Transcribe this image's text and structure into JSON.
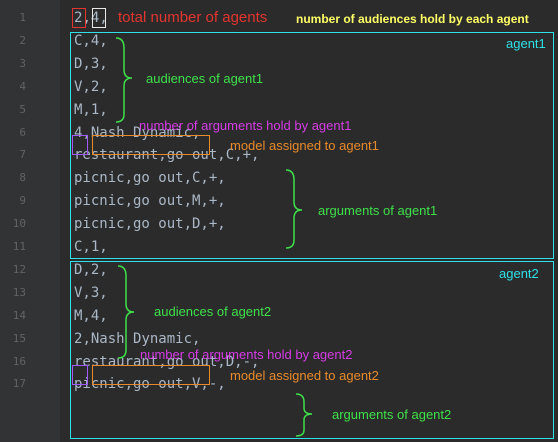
{
  "colors": {
    "background": "#2b2b2b",
    "gutter": "#313335",
    "line_number": "#606366",
    "code": "#a9b7c6",
    "red": "#e3342f",
    "magenta": "#d63be6",
    "orange": "#e88a2a",
    "green": "#3ee04a",
    "yellow": "#ffff66",
    "cyan": "#2fe0e8",
    "purple": "#9b59ff"
  },
  "line_numbers": [
    "1",
    "2",
    "3",
    "4",
    "5",
    "6",
    "7",
    "8",
    "9",
    "10",
    "11",
    "12",
    "13",
    "14",
    "15",
    "16",
    "17"
  ],
  "code_lines": [
    {
      "pre": "",
      "a": "2",
      "sep": ",",
      "b": "4",
      "post": ","
    },
    {
      "text": "C,4,"
    },
    {
      "text": "D,3,"
    },
    {
      "text": "V,2,"
    },
    {
      "text": "M,1,"
    },
    {
      "pre": "",
      "a": "4",
      "sep": ",",
      "b": "Nash Dynamic",
      "post": ","
    },
    {
      "text": "restaurant,go out,C,+,"
    },
    {
      "text": "picnic,go out,C,+,"
    },
    {
      "text": "picnic,go out,M,+,"
    },
    {
      "text": "picnic,go out,D,+,"
    },
    {
      "text": "C,1,"
    },
    {
      "text": "D,2,"
    },
    {
      "text": "V,3,"
    },
    {
      "text": "M,4,"
    },
    {
      "pre": "",
      "a": "2",
      "sep": ",",
      "b": "Nash Dynamic",
      "post": ","
    },
    {
      "text": "restaurant,go out,D,-,"
    },
    {
      "text": "picnic,go out,V,-,"
    }
  ],
  "annotations": {
    "total_agents": "total number of agents",
    "audiences_per_agent": "number of audiences hold by each agent",
    "agent1_label": "agent1",
    "audiences_agent1": "audiences of agent1",
    "num_arguments_agent1": "number of arguments hold by agent1",
    "model_agent1": "model assigned to agent1",
    "arguments_agent1": "arguments of agent1",
    "agent2_label": "agent2",
    "audiences_agent2": "audiences of agent2",
    "num_arguments_agent2": "number of arguments hold by agent2",
    "model_agent2": "model assigned to agent2",
    "arguments_agent2": "arguments of agent2"
  }
}
